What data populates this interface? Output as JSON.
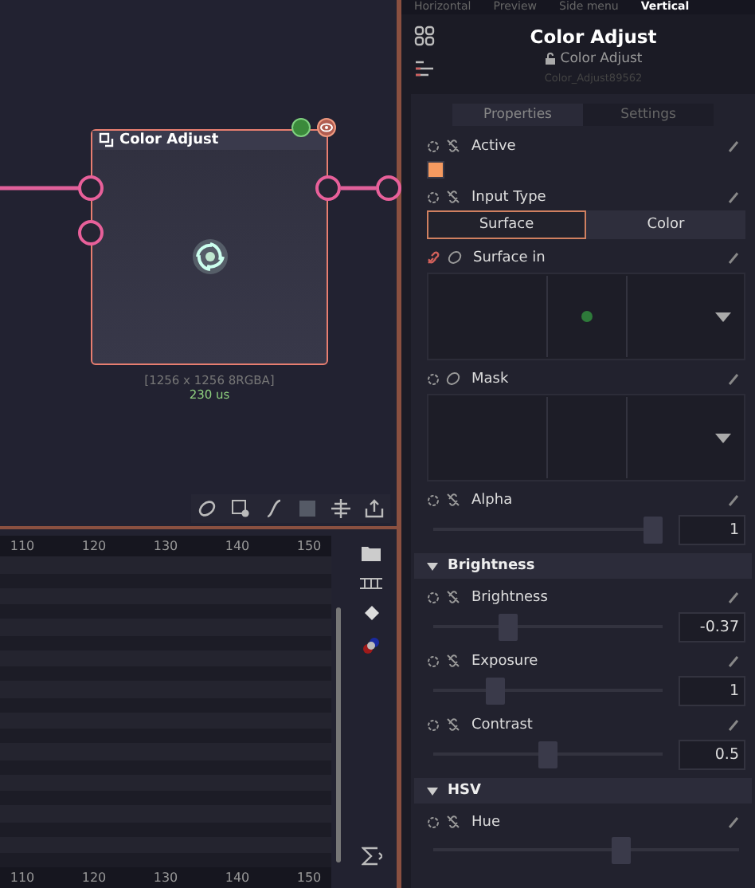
{
  "top_tabs": [
    {
      "label": "Horizontal",
      "selected": false
    },
    {
      "label": "Preview",
      "selected": false
    },
    {
      "label": "Side menu",
      "selected": false
    },
    {
      "label": "Vertical",
      "selected": true
    }
  ],
  "graph": {
    "node": {
      "title": "Color Adjust",
      "resolution": "[1256 x 1256 8RGBA]",
      "time": "230 us"
    }
  },
  "timeline": {
    "top_ticks": [
      "110",
      "120",
      "130",
      "140",
      "150"
    ],
    "bottom_ticks": [
      "110",
      "120",
      "130",
      "140",
      "150"
    ]
  },
  "inspector": {
    "title": "Color Adjust",
    "subtitle": "Color Adjust",
    "node_id": "Color_Adjust89562",
    "tabs": [
      {
        "label": "Properties",
        "selected": true
      },
      {
        "label": "Settings",
        "selected": false
      }
    ],
    "items": [
      {
        "kind": "checkbox",
        "label": "Active",
        "checked": true
      },
      {
        "kind": "choice",
        "label": "Input Type",
        "options": [
          {
            "label": "Surface",
            "selected": true
          },
          {
            "label": "Color",
            "selected": false
          }
        ]
      },
      {
        "kind": "surface",
        "label": "Surface in",
        "linked": true,
        "preview": true
      },
      {
        "kind": "surface",
        "label": "Mask",
        "linked": false,
        "preview": false
      },
      {
        "kind": "slider",
        "label": "Alpha",
        "level": 1,
        "value": "1"
      },
      {
        "kind": "header",
        "label": "Brightness",
        "expanded": true
      },
      {
        "kind": "slider",
        "label": "Brightness",
        "level": 0.31,
        "value": "-0.37"
      },
      {
        "kind": "slider",
        "label": "Exposure",
        "level": 0.25,
        "value": "1"
      },
      {
        "kind": "slider",
        "label": "Contrast",
        "level": 0.5,
        "value": "0.5"
      },
      {
        "kind": "header",
        "label": "HSV",
        "expanded": true
      },
      {
        "kind": "slider",
        "label": "Hue",
        "level": 0.62
      }
    ]
  }
}
